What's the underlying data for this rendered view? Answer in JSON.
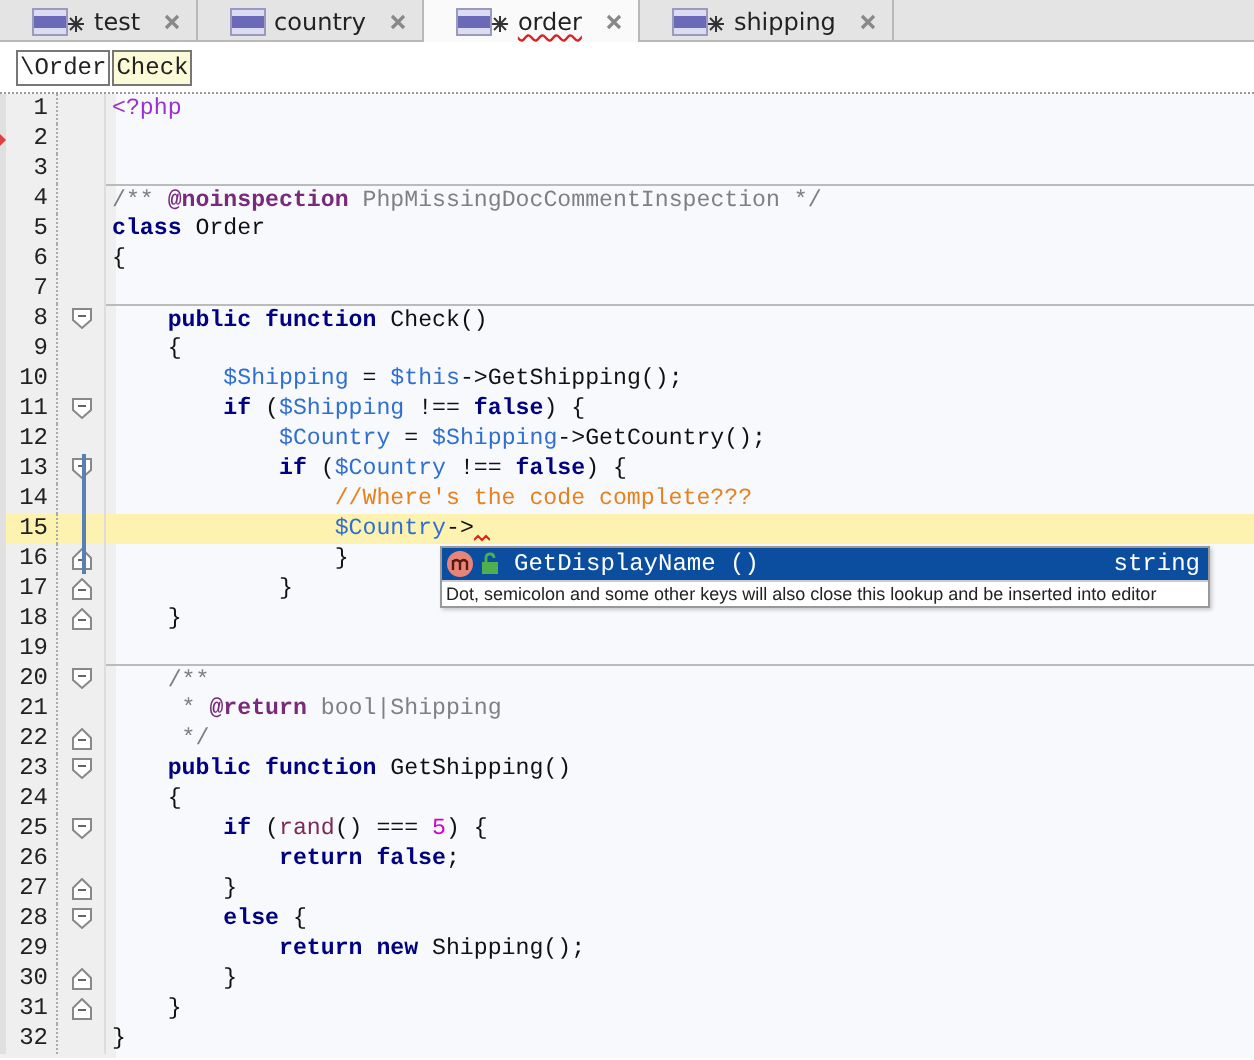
{
  "tabs": [
    {
      "label": "test",
      "badge": true,
      "selected": false,
      "spell_error": false
    },
    {
      "label": "country",
      "badge": false,
      "selected": false,
      "spell_error": false
    },
    {
      "label": "order",
      "badge": true,
      "selected": true,
      "spell_error": true
    },
    {
      "label": "shipping",
      "badge": true,
      "selected": false,
      "spell_error": false
    }
  ],
  "breadcrumbs": [
    {
      "label": "\\Order",
      "selected": false
    },
    {
      "label": "Check",
      "selected": true
    }
  ],
  "lines": [
    {
      "number": "1",
      "tokens": [
        {
          "kind": "php-tag",
          "text": "<?php"
        }
      ]
    },
    {
      "number": "2",
      "marker": true
    },
    {
      "number": "3"
    },
    {
      "number": "4",
      "separator_above": true,
      "tokens": [
        {
          "kind": "doc",
          "text": "/** "
        },
        {
          "kind": "doc-tag",
          "text": "@noinspection"
        },
        {
          "kind": "doc",
          "text": " PhpMissingDocCommentInspection */"
        }
      ]
    },
    {
      "number": "5",
      "tokens": [
        {
          "kind": "keyword",
          "text": "class"
        },
        {
          "kind": "plain",
          "text": " Order"
        }
      ]
    },
    {
      "number": "6",
      "tokens": [
        {
          "kind": "plain",
          "text": "{"
        }
      ]
    },
    {
      "number": "7"
    },
    {
      "number": "8",
      "separator_above": true,
      "fold_open": true,
      "tokens": [
        {
          "kind": "keyword",
          "text": "    public function"
        },
        {
          "kind": "plain",
          "text": " Check()"
        }
      ]
    },
    {
      "number": "9",
      "tokens": [
        {
          "kind": "plain",
          "text": "    {"
        }
      ]
    },
    {
      "number": "10",
      "tokens": [
        {
          "kind": "var",
          "text": "        $Shipping"
        },
        {
          "kind": "plain",
          "text": " = "
        },
        {
          "kind": "var",
          "text": "$this"
        },
        {
          "kind": "plain",
          "text": "->GetShipping();"
        }
      ]
    },
    {
      "number": "11",
      "fold_open": true,
      "tokens": [
        {
          "kind": "keyword",
          "text": "        if"
        },
        {
          "kind": "plain",
          "text": " ("
        },
        {
          "kind": "var",
          "text": "$Shipping"
        },
        {
          "kind": "plain",
          "text": " !== "
        },
        {
          "kind": "keyword",
          "text": "false"
        },
        {
          "kind": "plain",
          "text": ") {"
        }
      ]
    },
    {
      "number": "12",
      "tokens": [
        {
          "kind": "var",
          "text": "            $Country"
        },
        {
          "kind": "plain",
          "text": " = "
        },
        {
          "kind": "var",
          "text": "$Shipping"
        },
        {
          "kind": "plain",
          "text": "->GetCountry();"
        }
      ]
    },
    {
      "number": "13",
      "fold_open": true,
      "scope": true,
      "tokens": [
        {
          "kind": "keyword",
          "text": "            if"
        },
        {
          "kind": "plain",
          "text": " ("
        },
        {
          "kind": "var",
          "text": "$Country"
        },
        {
          "kind": "plain",
          "text": " !== "
        },
        {
          "kind": "keyword",
          "text": "false"
        },
        {
          "kind": "plain",
          "text": ") {"
        }
      ]
    },
    {
      "number": "14",
      "scope": true,
      "tokens": [
        {
          "kind": "comment",
          "text": "                //Where's the code complete???"
        }
      ]
    },
    {
      "number": "15",
      "scope": true,
      "current": true,
      "error_mark": true,
      "tokens": [
        {
          "kind": "var",
          "text": "                $Country"
        },
        {
          "kind": "plain",
          "text": "->"
        }
      ]
    },
    {
      "number": "16",
      "fold_close": true,
      "scope": true,
      "tokens": [
        {
          "kind": "plain",
          "text": "                }"
        }
      ]
    },
    {
      "number": "17",
      "fold_close": true,
      "tokens": [
        {
          "kind": "plain",
          "text": "            }"
        }
      ]
    },
    {
      "number": "18",
      "fold_close": true,
      "tokens": [
        {
          "kind": "plain",
          "text": "    }"
        }
      ]
    },
    {
      "number": "19"
    },
    {
      "number": "20",
      "separator_above": true,
      "fold_open": true,
      "tokens": [
        {
          "kind": "doc",
          "text": "    /**"
        }
      ]
    },
    {
      "number": "21",
      "tokens": [
        {
          "kind": "doc",
          "text": "     * "
        },
        {
          "kind": "doc-tag",
          "text": "@return"
        },
        {
          "kind": "doc",
          "text": " bool|Shipping"
        }
      ]
    },
    {
      "number": "22",
      "fold_close": true,
      "tokens": [
        {
          "kind": "doc",
          "text": "     */"
        }
      ]
    },
    {
      "number": "23",
      "fold_open": true,
      "tokens": [
        {
          "kind": "keyword",
          "text": "    public function"
        },
        {
          "kind": "plain",
          "text": " GetShipping()"
        }
      ]
    },
    {
      "number": "24",
      "tokens": [
        {
          "kind": "plain",
          "text": "    {"
        }
      ]
    },
    {
      "number": "25",
      "fold_open": true,
      "tokens": [
        {
          "kind": "keyword",
          "text": "        if"
        },
        {
          "kind": "plain",
          "text": " ("
        },
        {
          "kind": "func",
          "text": "rand"
        },
        {
          "kind": "plain",
          "text": "() === "
        },
        {
          "kind": "number",
          "text": "5"
        },
        {
          "kind": "plain",
          "text": ") {"
        }
      ]
    },
    {
      "number": "26",
      "tokens": [
        {
          "kind": "keyword",
          "text": "            return false"
        },
        {
          "kind": "plain",
          "text": ";"
        }
      ]
    },
    {
      "number": "27",
      "fold_close": true,
      "tokens": [
        {
          "kind": "plain",
          "text": "        }"
        }
      ]
    },
    {
      "number": "28",
      "fold_open": true,
      "tokens": [
        {
          "kind": "keyword",
          "text": "        else"
        },
        {
          "kind": "plain",
          "text": " {"
        }
      ]
    },
    {
      "number": "29",
      "tokens": [
        {
          "kind": "keyword",
          "text": "            return new"
        },
        {
          "kind": "plain",
          "text": " Shipping();"
        }
      ]
    },
    {
      "number": "30",
      "fold_close": true,
      "tokens": [
        {
          "kind": "plain",
          "text": "        }"
        }
      ]
    },
    {
      "number": "31",
      "fold_close": true,
      "tokens": [
        {
          "kind": "plain",
          "text": "    }"
        }
      ]
    },
    {
      "number": "32",
      "tokens": [
        {
          "kind": "plain",
          "text": "}"
        }
      ]
    }
  ],
  "completion": {
    "items": [
      {
        "name": "GetDisplayName",
        "params": "()",
        "type": "string",
        "selected": true
      }
    ],
    "hint": "Dot, semicolon and some other keys will also close this lookup and be inserted into editor"
  }
}
